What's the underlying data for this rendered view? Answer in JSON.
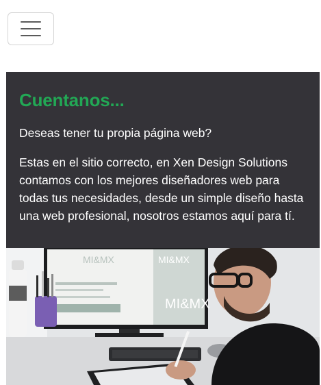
{
  "navbar": {
    "toggle_icon": "hamburger-icon"
  },
  "card": {
    "title": "Cuentanos...",
    "question": "Deseas tener tu propia página web?",
    "text": "Estas en el sitio correcto, en Xen Design Solutions contamos con los mejores diseñadores web para todas tus necesidades, desde un simple diseño hasta una web profesional, nosotros estamos aquí para tí.",
    "colors": {
      "background": "#343338",
      "title": "#22a855",
      "text": "#ffffff"
    },
    "image": {
      "description_icon": "designer-at-desk-photo",
      "screen_brand": "MI&MX"
    }
  }
}
